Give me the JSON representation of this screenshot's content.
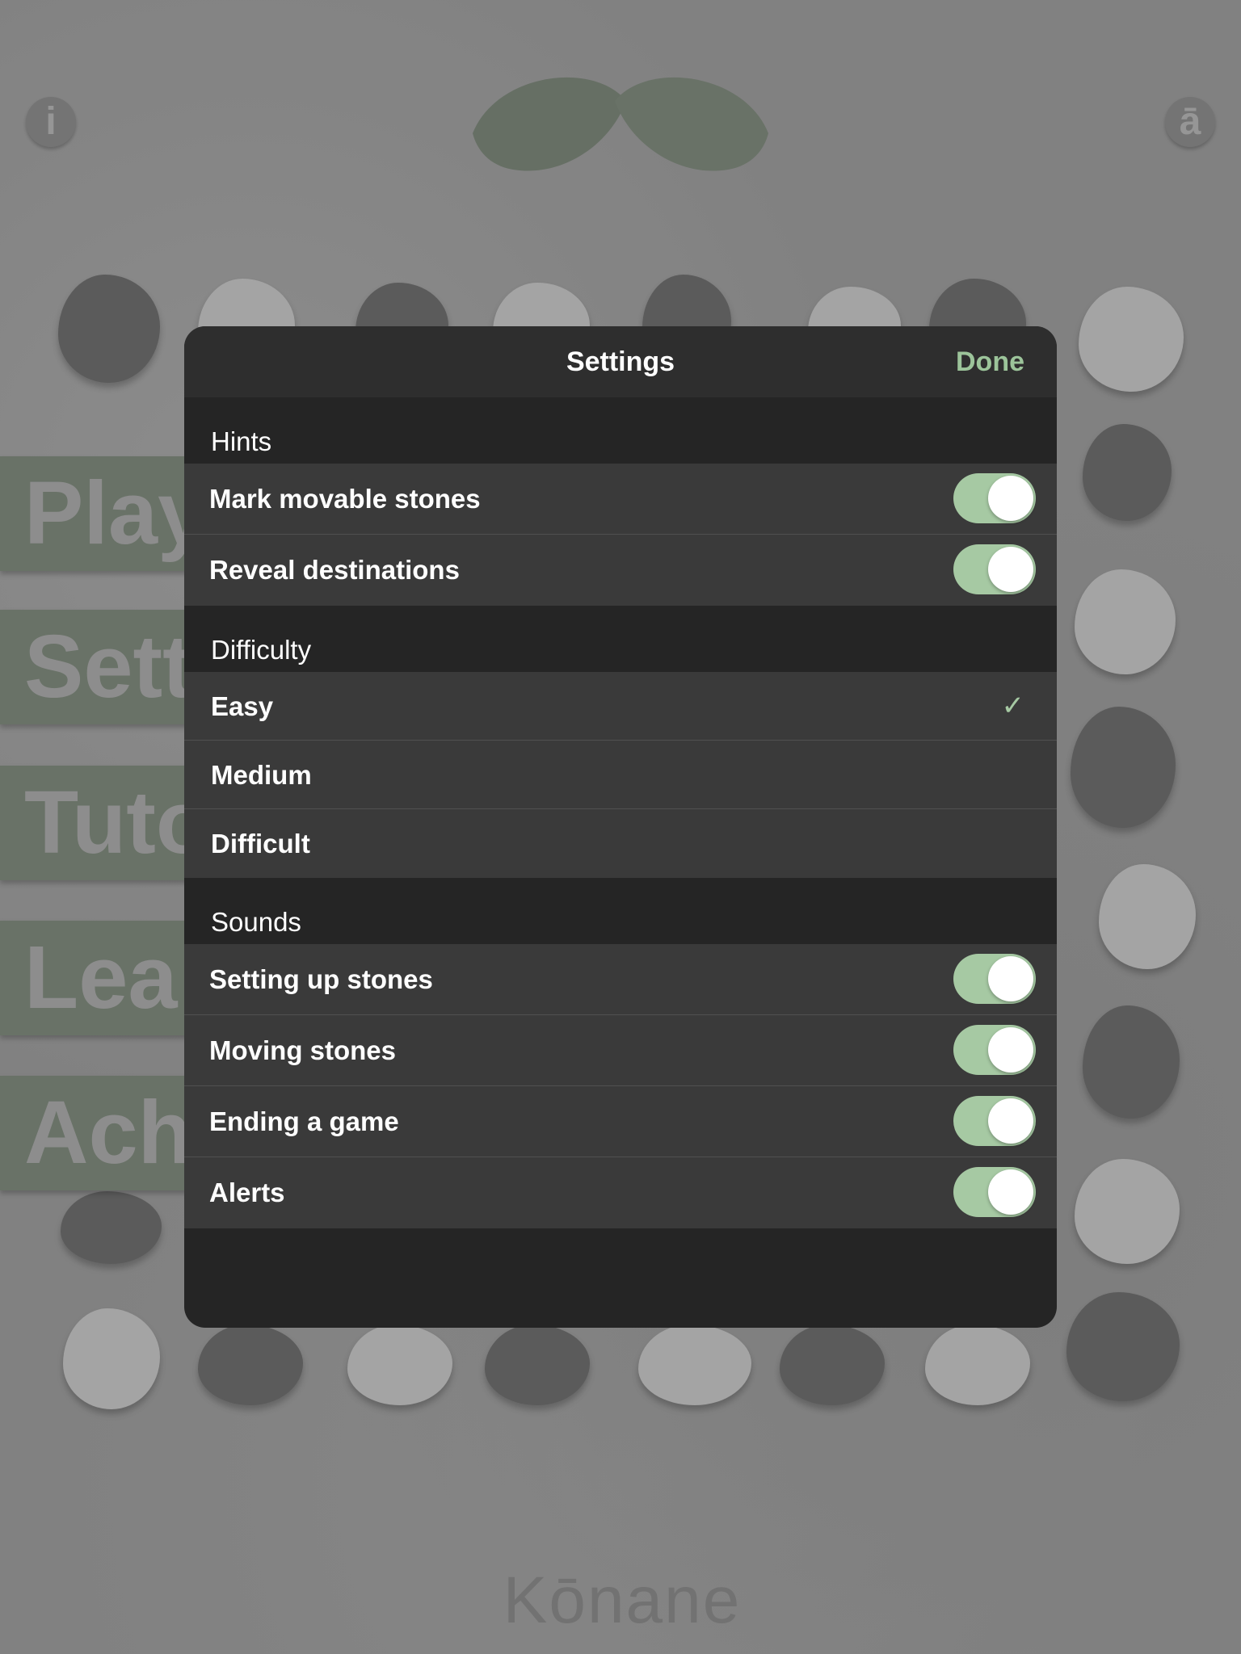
{
  "background": {
    "info_button_glyph": "i",
    "language_button_glyph": "ā",
    "menu_items": [
      "Play",
      "Sett",
      "Tuto",
      "Lea",
      "Ach"
    ],
    "brand": "Kōnane"
  },
  "settings": {
    "title": "Settings",
    "done_label": "Done",
    "accent_color": "#a6c9a3",
    "sections": {
      "hints": {
        "header": "Hints",
        "rows": [
          {
            "label": "Mark movable stones",
            "on": true
          },
          {
            "label": "Reveal destinations",
            "on": true
          }
        ]
      },
      "difficulty": {
        "header": "Difficulty",
        "options": [
          "Easy",
          "Medium",
          "Difficult"
        ],
        "selected": "Easy",
        "checkmark": "✓"
      },
      "sounds": {
        "header": "Sounds",
        "rows": [
          {
            "label": "Setting up stones",
            "on": true
          },
          {
            "label": "Moving stones",
            "on": true
          },
          {
            "label": "Ending a game",
            "on": true
          },
          {
            "label": "Alerts",
            "on": true
          }
        ]
      }
    }
  }
}
